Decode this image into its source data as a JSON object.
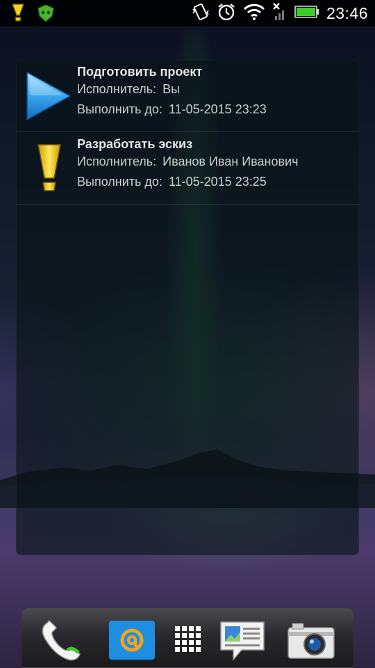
{
  "status_bar": {
    "notification_icons": [
      "exclamation-icon",
      "lookout-shield-icon"
    ],
    "system_icons": [
      "vibrate-icon",
      "alarm-icon",
      "wifi-icon",
      "no-signal-icon",
      "battery-icon"
    ],
    "time": "23:46"
  },
  "widget": {
    "tasks": [
      {
        "icon": "play-arrow-icon",
        "title": "Подготовить проект",
        "assignee_label": "Исполнитель:",
        "assignee": "Вы",
        "due_label": "Выполнить до:",
        "due": "11-05-2015 23:23"
      },
      {
        "icon": "exclamation-icon",
        "title": "Разработать эскиз",
        "assignee_label": "Исполнитель:",
        "assignee": "Иванов Иван Иванович",
        "due_label": "Выполнить до:",
        "due": "11-05-2015 23:25"
      }
    ]
  },
  "dock": {
    "items": [
      "phone-icon",
      "mail-at-icon",
      "app-drawer-icon",
      "messages-icon",
      "camera-icon"
    ]
  },
  "colors": {
    "status_bar_bg": "#000000",
    "play_blue": "#3aa6f0",
    "exclamation_yellow": "#f2d21c",
    "battery_green": "#3ccc2a",
    "mail_blue": "#1e8fe0",
    "mail_at_orange": "#f7a21b"
  }
}
